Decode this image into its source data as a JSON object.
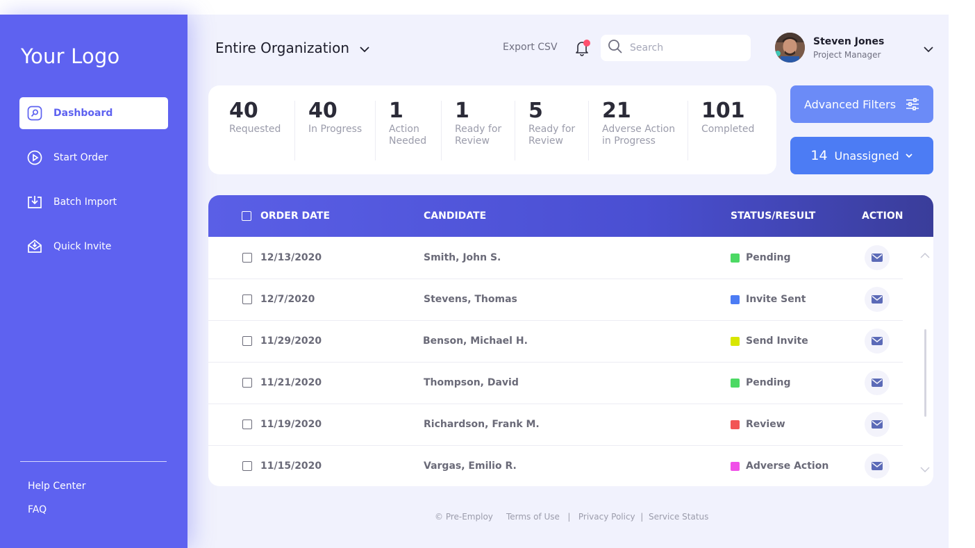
{
  "sidebar": {
    "logo": "Your Logo",
    "items": [
      {
        "label": "Dashboard",
        "icon": "dashboard-icon",
        "active": true
      },
      {
        "label": "Start Order",
        "icon": "play-icon"
      },
      {
        "label": "Batch Import",
        "icon": "import-icon"
      },
      {
        "label": "Quick Invite",
        "icon": "invite-icon"
      }
    ],
    "help": "Help Center",
    "faq": "FAQ"
  },
  "header": {
    "org": "Entire Organization",
    "export": "Export CSV",
    "search_placeholder": "Search",
    "user": {
      "name": "Steven Jones",
      "role": "Project Manager"
    }
  },
  "stats": [
    {
      "value": "40",
      "label1": "Requested",
      "label2": ""
    },
    {
      "value": "40",
      "label1": "In Progress",
      "label2": ""
    },
    {
      "value": "1",
      "label1": "Action",
      "label2": "Needed"
    },
    {
      "value": "1",
      "label1": "Ready for",
      "label2": "Review"
    },
    {
      "value": "5",
      "label1": "Ready for",
      "label2": "Review"
    },
    {
      "value": "21",
      "label1": "Adverse Action",
      "label2": "in Progress"
    },
    {
      "value": "101",
      "label1": "Completed",
      "label2": ""
    }
  ],
  "buttons": {
    "advanced_filters": "Advanced Filters",
    "unassigned_count": "14",
    "unassigned_label": "Unassigned"
  },
  "table": {
    "headers": {
      "order_date": "ORDER DATE",
      "candidate": "CANDIDATE",
      "status": "STATUS/RESULT",
      "action": "ACTION"
    },
    "rows": [
      {
        "date": "12/13/2020",
        "candidate": "Smith, John S.",
        "status": "Pending",
        "color": "#4cd964"
      },
      {
        "date": "12/7/2020",
        "candidate": "Stevens, Thomas",
        "status": "Invite Sent",
        "color": "#4c7cf4"
      },
      {
        "date": "11/29/2020",
        "candidate": "Benson, Michael H.",
        "status": "Send Invite",
        "color": "#d8e600"
      },
      {
        "date": "11/21/2020",
        "candidate": "Thompson, David",
        "status": "Pending",
        "color": "#4cd964"
      },
      {
        "date": "11/19/2020",
        "candidate": "Richardson, Frank M.",
        "status": "Review",
        "color": "#f25555"
      },
      {
        "date": "11/15/2020",
        "candidate": "Vargas, Emilio R.",
        "status": "Adverse Action",
        "color": "#f04fe8"
      }
    ]
  },
  "footer": {
    "copyright": "© Pre-Employ",
    "terms": "Terms of Use",
    "sep": "|",
    "privacy": "Privacy Policy",
    "service": "Service Status"
  },
  "colors": {
    "sidebar": "#5e62f0",
    "accent": "#4c7cf4",
    "background": "#f1f2fd"
  }
}
